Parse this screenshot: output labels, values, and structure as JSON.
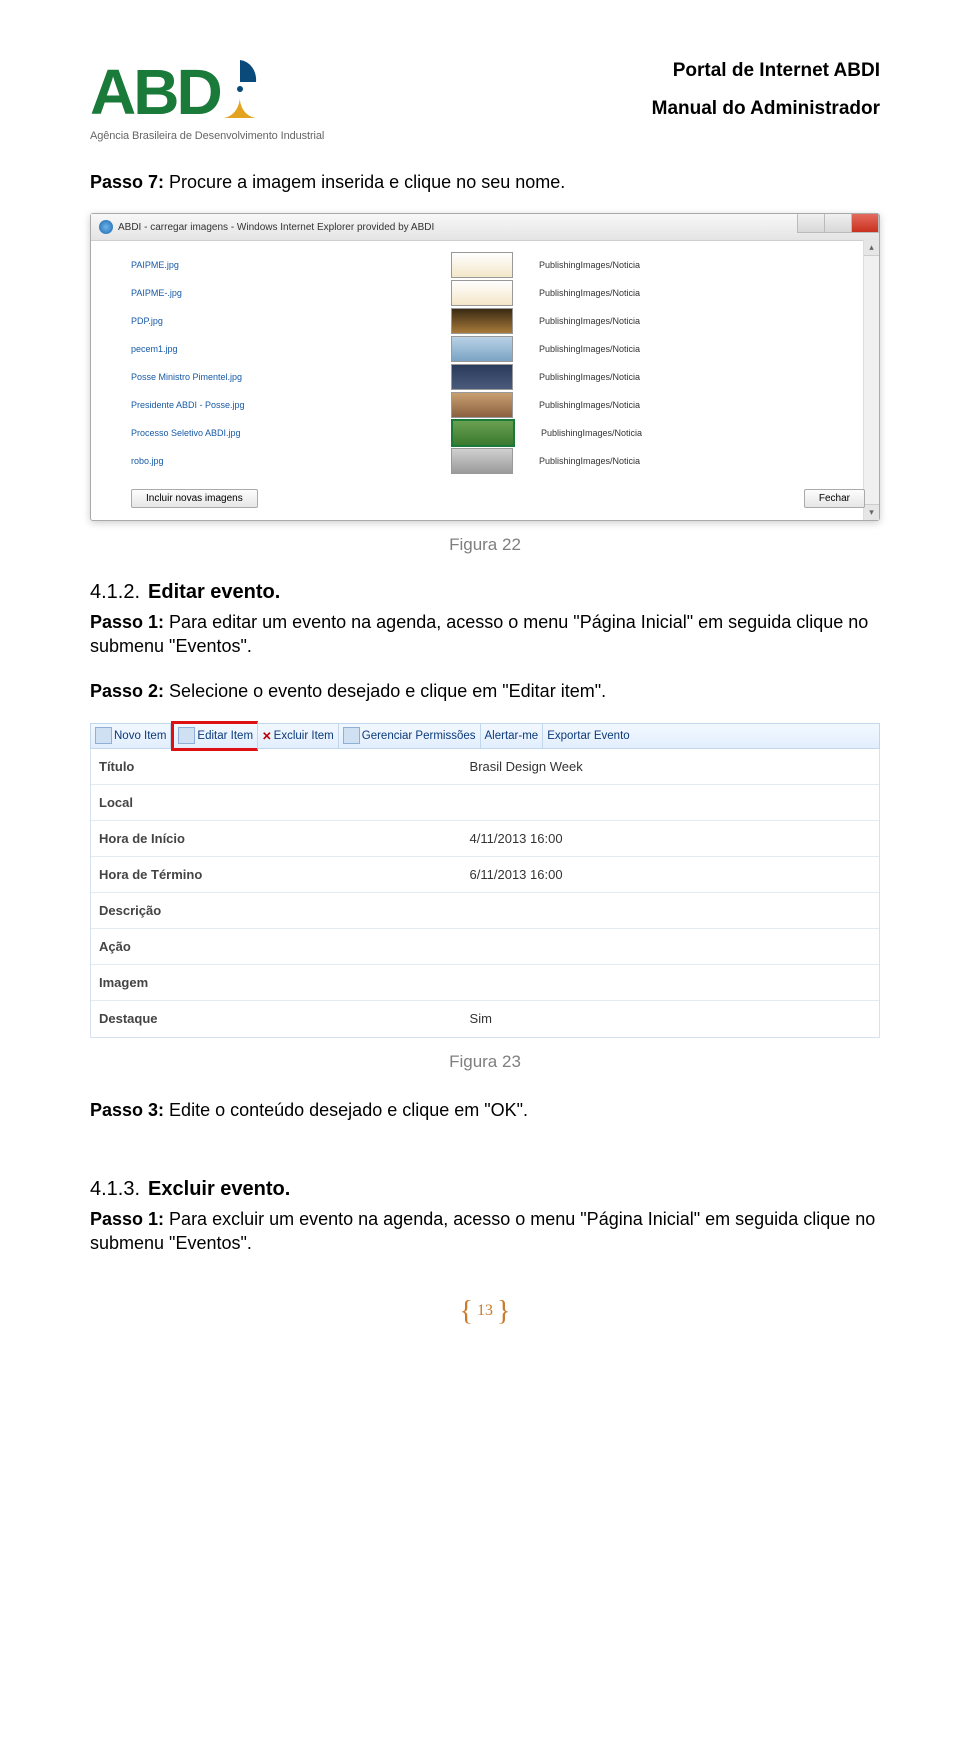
{
  "header": {
    "portal": "Portal de Internet ABDI",
    "manual": "Manual do Administrador",
    "logo_tagline": "Agência Brasileira de Desenvolvimento Industrial",
    "logo_letters": "ABD"
  },
  "passo7": {
    "label": "Passo  7:",
    "text": " Procure a imagem inserida e clique no seu nome."
  },
  "screenshot1": {
    "window_title": "ABDI - carregar imagens - Windows Internet Explorer provided by ABDI",
    "rows": [
      {
        "fn": "PAIPME.jpg",
        "path": "PublishingImages/Noticia"
      },
      {
        "fn": "PAIPME-.jpg",
        "path": "PublishingImages/Noticia"
      },
      {
        "fn": "PDP.jpg",
        "path": "PublishingImages/Noticia"
      },
      {
        "fn": "pecem1.jpg",
        "path": "PublishingImages/Noticia"
      },
      {
        "fn": "Posse Ministro Pimentel.jpg",
        "path": "PublishingImages/Noticia"
      },
      {
        "fn": "Presidente ABDI - Posse.jpg",
        "path": "PublishingImages/Noticia"
      },
      {
        "fn": "Processo Seletivo ABDI.jpg",
        "path": "PublishingImages/Noticia"
      },
      {
        "fn": "robo.jpg",
        "path": "PublishingImages/Noticia"
      }
    ],
    "btn_incluir": "Incluir novas imagens",
    "btn_fechar": "Fechar"
  },
  "fig22": "Figura 22",
  "sec412": {
    "num": "4.1.2.",
    "title": "Editar evento."
  },
  "passo1_edit": {
    "label": "Passo 1:",
    "text": " Para editar um evento na agenda, acesso o menu \"Página Inicial\" em seguida clique no submenu \"Eventos\"."
  },
  "passo2": {
    "label": "Passo 2:",
    "text": " Selecione o evento desejado e clique em \"Editar item\"."
  },
  "screenshot2": {
    "toolbar": {
      "novo": "Novo Item",
      "editar": "Editar Item",
      "excluir": "Excluir Item",
      "gerenciar": "Gerenciar Permissões",
      "alertar": "Alertar-me",
      "exportar": "Exportar Evento"
    },
    "rows": [
      {
        "label": "Título",
        "value": "Brasil Design Week"
      },
      {
        "label": "Local",
        "value": ""
      },
      {
        "label": "Hora de Início",
        "value": "4/11/2013 16:00"
      },
      {
        "label": "Hora de Término",
        "value": "6/11/2013 16:00"
      },
      {
        "label": "Descrição",
        "value": ""
      },
      {
        "label": "Ação",
        "value": ""
      },
      {
        "label": "Imagem",
        "value": ""
      },
      {
        "label": "Destaque",
        "value": "Sim"
      }
    ]
  },
  "fig23": "Figura 23",
  "passo3": {
    "label": "Passo 3:",
    "text": " Edite o conteúdo desejado e clique em \"OK\"."
  },
  "sec413": {
    "num": "4.1.3.",
    "title": "Excluir evento."
  },
  "passo1_excl": {
    "label": "Passo 1:",
    "text": " Para excluir um evento na agenda, acesso o menu \"Página Inicial\" em seguida clique no submenu \"Eventos\"."
  },
  "pageno": "13"
}
